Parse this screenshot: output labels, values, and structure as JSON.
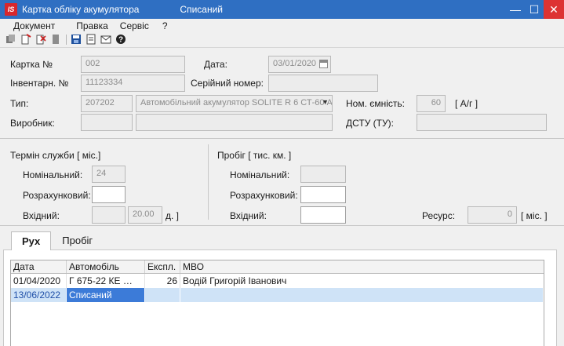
{
  "window": {
    "title": "Картка обліку акумулятора",
    "status": "Списаний",
    "app_icon": "IS",
    "minimize": "—",
    "maximize": "☐",
    "close": "✕"
  },
  "menu": [
    "Документ",
    "Правка",
    "Сервіс",
    "?"
  ],
  "toolbar": {
    "icons": [
      "copy-icon",
      "new-doc-icon",
      "delete-doc-icon",
      "stamp-icon",
      "save-icon",
      "settings-doc-icon",
      "mail-icon",
      "help-icon"
    ]
  },
  "form": {
    "card_label": "Картка №",
    "card_value": "002",
    "date_label": "Дата:",
    "date_value": "03/01/2020",
    "inv_label": "Інвентарн. №",
    "inv_value": "11123334",
    "serial_label": "Серійний номер:",
    "serial_value": "",
    "type_label": "Тип:",
    "type_code": "207202",
    "type_name": "Автомобільний акумулятор SOLITE R 6 СТ-60 А",
    "capacity_label": "Ном. ємність:",
    "capacity_value": "60",
    "capacity_unit": "[ А/г ]",
    "maker_label": "Виробник:",
    "maker_code": "",
    "maker_name": "",
    "dstu_label": "ДСТУ (ТУ):",
    "dstu_value": ""
  },
  "service_life": {
    "title": "Термін служби [ міс.]",
    "nominal_label": "Номінальний:",
    "nominal_value": "24",
    "calc_label": "Розрахунковий:",
    "calc_value": "",
    "input_label": "Вхідний:",
    "input_value": "",
    "input_value2": "20.00",
    "input_unit": "д. ]"
  },
  "mileage": {
    "title": "Пробіг [ тис. км. ]",
    "nominal_label": "Номінальний:",
    "nominal_value": "",
    "calc_label": "Розрахунковий:",
    "calc_value": "",
    "input_label": "Вхідний:",
    "input_value": "",
    "resource_label": "Ресурс:",
    "resource_value": "0",
    "resource_unit": "[ міс. ]"
  },
  "tabs": [
    "Рух",
    "Пробіг"
  ],
  "grid": {
    "headers": [
      "Дата",
      "Автомобіль",
      "Експл.",
      "МВО"
    ],
    "rows": [
      [
        "01/04/2020",
        "Г 675-22 КЕ      …",
        "26",
        "Водій Григорій Іванович"
      ],
      [
        "13/06/2022",
        "Списаний",
        "",
        ""
      ]
    ]
  },
  "colors": {
    "titlebar": "#2f6fc2",
    "close_button": "#dd3333",
    "selection": "#cfe3f7",
    "selected_cell": "#3c7bd8"
  }
}
